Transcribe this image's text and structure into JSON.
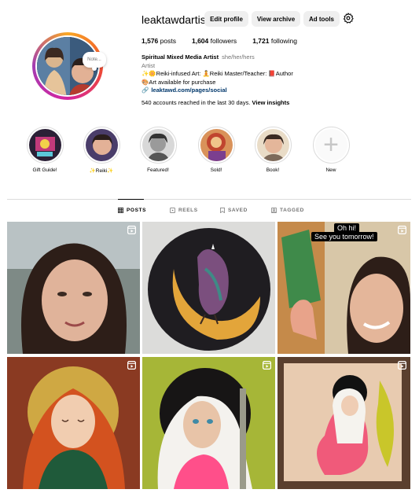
{
  "profile": {
    "username": "leaktawdartist",
    "note": "Note...",
    "buttons": {
      "edit": "Edit profile",
      "archive": "View archive",
      "ad_tools": "Ad tools"
    },
    "stats": {
      "posts": "1,576",
      "posts_label": "posts",
      "followers": "1,604",
      "followers_label": "followers",
      "following": "1,721",
      "following_label": "following"
    },
    "display_name": "Spiritual Mixed Media Artist",
    "pronouns": "she/her/hers",
    "category": "Artist",
    "bio_line1": "✨🌼Reiki-infused Art: 🧘Reiki Master/Teacher: 📕Author",
    "bio_line2": "🎨Art available for purchase",
    "link": "leaktawd.com/pages/social",
    "insights_text": "540 accounts reached in the last 30 days. ",
    "insights_link": "View insights"
  },
  "highlights": [
    {
      "label": "Gift Guide!"
    },
    {
      "label": "✨Reiki✨"
    },
    {
      "label": "Featured!"
    },
    {
      "label": "Sold!"
    },
    {
      "label": "Book!"
    },
    {
      "label": "New"
    }
  ],
  "tabs": {
    "posts": "POSTS",
    "reels": "REELS",
    "saved": "SAVED",
    "tagged": "TAGGED"
  },
  "grid": {
    "post3_caption1": "Oh hi!",
    "post3_caption2": "See you tomorrow!"
  },
  "colors": {
    "link": "#00376b",
    "muted": "#737373",
    "button_bg": "#efefef",
    "border": "#dbdbdb"
  }
}
